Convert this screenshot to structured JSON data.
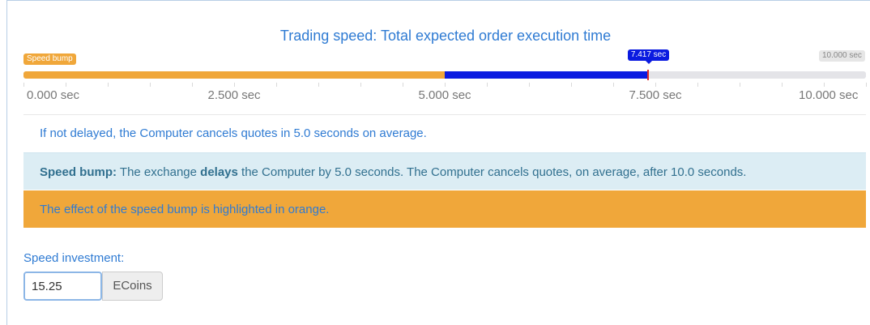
{
  "title": "Trading speed: Total expected order execution time",
  "bar": {
    "speed_bump_label": "Speed bump",
    "marker_label": "7.417 sec",
    "max_label": "10.000 sec",
    "orange_value_sec": 5.0,
    "marker_value_sec": 7.417,
    "max_value_sec": 10.0,
    "colors": {
      "orange": "#f0a73a",
      "blue": "#0b1be0",
      "marker": "#e02a2a",
      "track": "#e4e4e8"
    }
  },
  "axis": {
    "labels": [
      "0.000 sec",
      "2.500 sec",
      "5.000 sec",
      "7.500 sec",
      "10.000 sec"
    ]
  },
  "info": {
    "line1": "If not delayed, the Computer cancels quotes in 5.0 seconds on average.",
    "line2_bold": "Speed bump:",
    "line2_a": " The exchange ",
    "line2_bold2": "delays",
    "line2_b": " the Computer by 5.0 seconds. The Computer cancels quotes, on average, after 10.0 seconds.",
    "line3": "The effect of the speed bump is highlighted in orange."
  },
  "form": {
    "label": "Speed investment:",
    "value": "15.25",
    "unit": "ECoins"
  }
}
